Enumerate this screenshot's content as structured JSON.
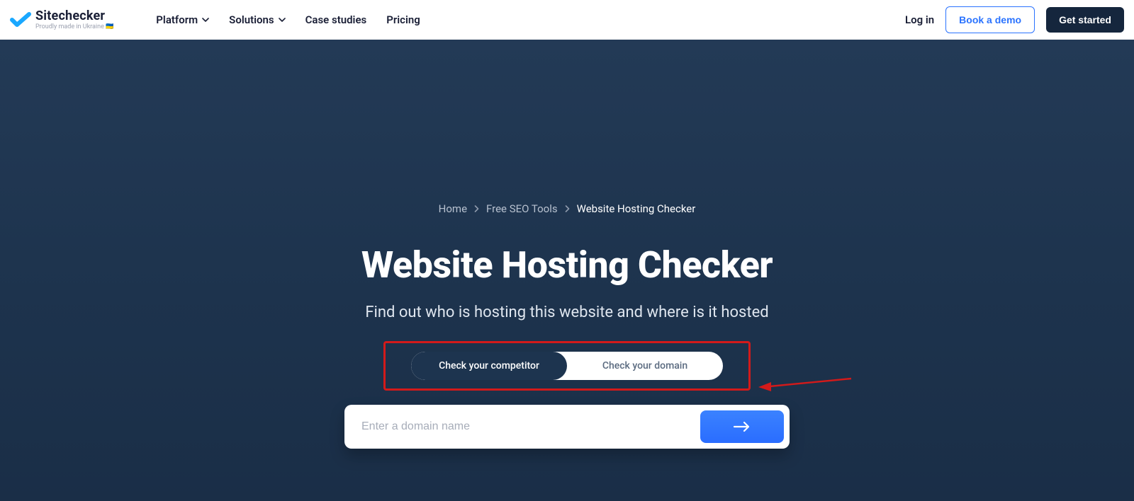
{
  "header": {
    "logo_title": "Sitechecker",
    "logo_subtitle": "Proudly made in Ukraine 🇺🇦",
    "nav": {
      "platform": "Platform",
      "solutions": "Solutions",
      "case_studies": "Case studies",
      "pricing": "Pricing"
    },
    "login": "Log in",
    "book_demo": "Book a demo",
    "get_started": "Get started"
  },
  "breadcrumb": {
    "home": "Home",
    "tools": "Free SEO Tools",
    "current": "Website Hosting Checker"
  },
  "hero": {
    "title": "Website Hosting Checker",
    "subtitle": "Find out who is hosting this website and where is it hosted",
    "toggle": {
      "competitor": "Check your competitor",
      "domain": "Check your domain"
    },
    "search_placeholder": "Enter a domain name"
  },
  "colors": {
    "accent_blue": "#2a73ff",
    "dark_navy": "#15263d",
    "annotation_red": "#d31a1a"
  }
}
